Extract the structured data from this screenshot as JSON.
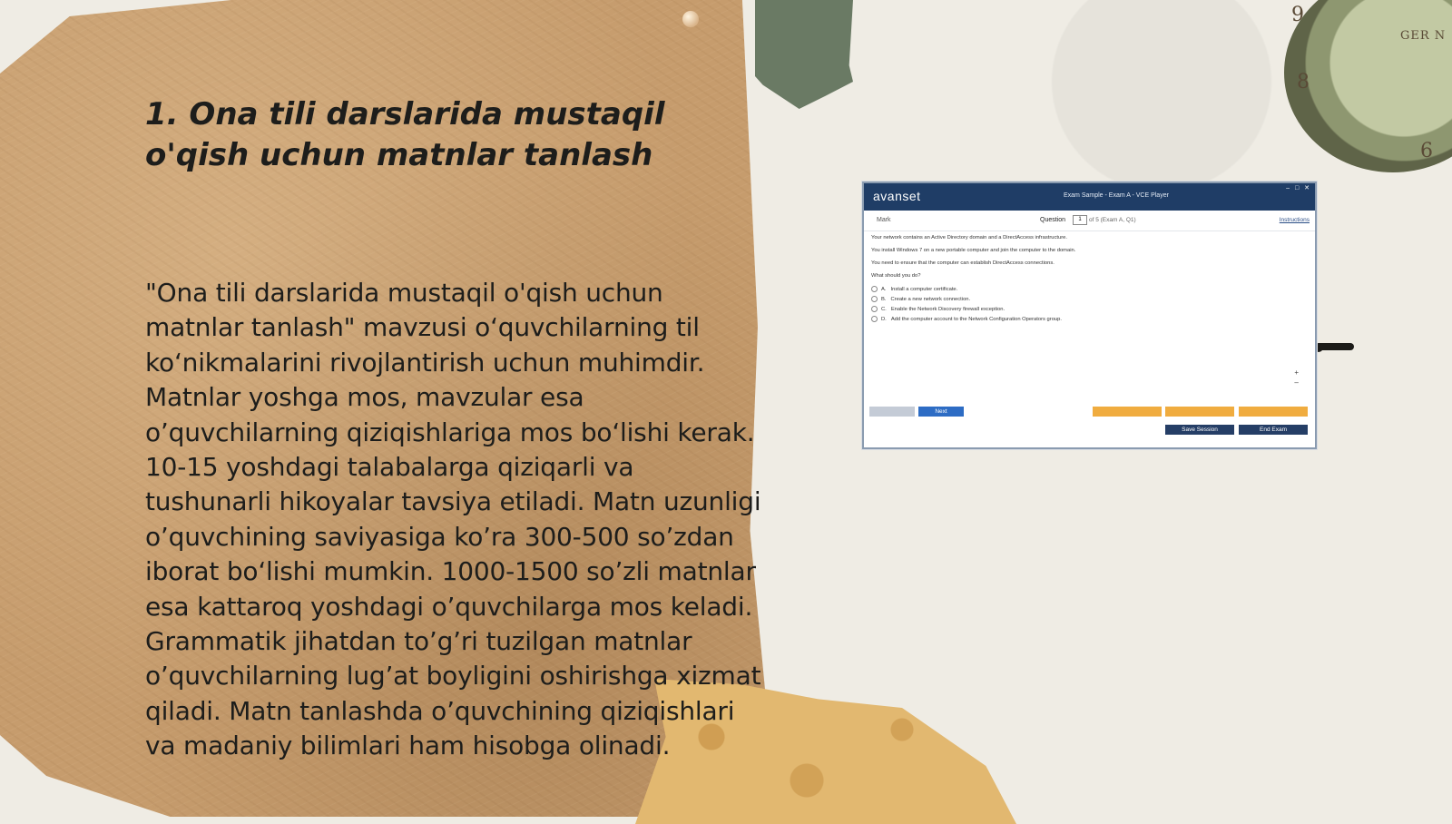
{
  "slide": {
    "title": "1. Ona tili darslarida mustaqil o'qish uchun matnlar tanlash",
    "body": "\"Ona tili darslarida mustaqil o'qish uchun matnlar tanlash\" mavzusi o‘quvchilarning til ko‘nikmalarini rivojlantirish uchun muhimdir. Matnlar yoshga mos, mavzular esa o’quvchilarning qiziqishlariga mos bo‘lishi kerak. 10-15 yoshdagi talabalarga qiziqarli va tushunarli hikoyalar tavsiya etiladi. Matn uzunligi o’quvchining saviyasiga ko’ra 300-500 so’zdan iborat bo‘lishi mumkin. 1000-1500 so’zli matnlar esa kattaroq yoshdagi o’quvchilarga mos keladi. Grammatik jihatdan to’g’ri tuzilgan matnlar o’quvchilarning lug’at boyligini oshirishga xizmat qiladi. Matn tanlashda o’quvchining qiziqishlari va madaniy bilimlari ham hisobga olinadi."
  },
  "decor": {
    "clock_numbers": [
      "9",
      "8",
      "6"
    ],
    "clock_words": "GER N"
  },
  "vce": {
    "logo": "avanset",
    "window_title": "Exam Sample - Exam A - VCE Player",
    "window_controls": "– □ ✕",
    "mark": "Mark",
    "question_label": "Question",
    "question_number": "1",
    "question_of": "of 5 (Exam A, Q1)",
    "instructions": "Instructions",
    "lines": [
      "Your network contains an Active Directory domain and a DirectAccess infrastructure.",
      "You install Windows 7 on a new portable computer and join the computer to the domain.",
      "You need to ensure that the computer can establish DirectAccess connections.",
      "What should you do?"
    ],
    "options": [
      {
        "letter": "A.",
        "text": "Install a computer certificate."
      },
      {
        "letter": "B.",
        "text": "Create a new network connection."
      },
      {
        "letter": "C.",
        "text": "Enable the Network Discovery firewall exception."
      },
      {
        "letter": "D.",
        "text": "Add the computer account to the Network Configuration Operators group."
      }
    ],
    "zoom_in": "+",
    "zoom_out": "–",
    "btn_previous": "",
    "btn_next": "Next",
    "btn_orange1": "",
    "btn_orange2": "",
    "btn_orange3": "",
    "btn_save": "Save Session",
    "btn_end": "End Exam",
    "colors": {
      "titlebar": "#1f3d66",
      "next": "#2d6cc4",
      "orange": "#f0ac3f",
      "navy": "#253e66"
    }
  }
}
